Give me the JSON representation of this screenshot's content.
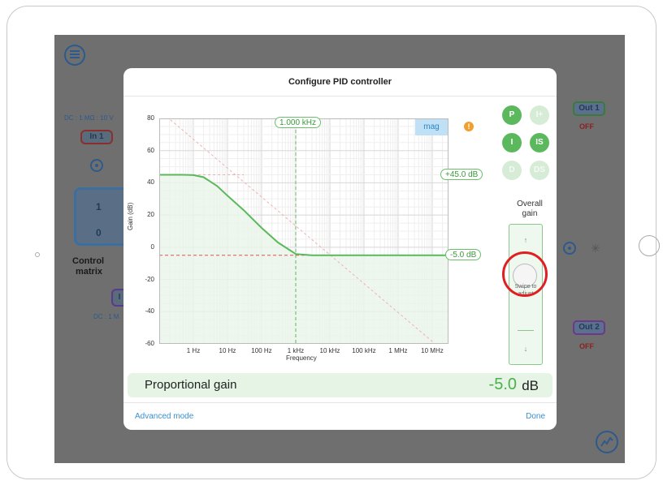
{
  "dialog": {
    "title": "Configure PID controller",
    "advanced_label": "Advanced mode",
    "done_label": "Done"
  },
  "chart": {
    "ylabel": "Gain (dB)",
    "xlabel": "Frequency",
    "y_ticks": [
      "80",
      "60",
      "40",
      "20",
      "0",
      "-20",
      "-40",
      "-60"
    ],
    "x_ticks": [
      "1 Hz",
      "10 Hz",
      "100 Hz",
      "1 kHz",
      "10 kHz",
      "100 kHz",
      "1 MHz",
      "10 MHz"
    ],
    "freq_marker": "1.000 kHz",
    "high_gain_marker": "+45.0 dB",
    "low_gain_marker": "-5.0 dB",
    "mode": "mag",
    "warning": "!"
  },
  "chart_data": {
    "type": "line",
    "x_scale": "log",
    "xlim_hz": [
      0.1,
      30000000
    ],
    "ylim": [
      -60,
      80
    ],
    "xlabel": "Frequency",
    "ylabel": "Gain (dB)",
    "series": [
      {
        "x_hz": [
          0.1,
          0.5,
          1,
          2,
          5,
          10,
          30,
          100,
          300,
          1000,
          3000,
          10000,
          100000,
          1000000,
          10000000,
          30000000
        ],
        "values": [
          45,
          45,
          44.8,
          43.5,
          38,
          32,
          23,
          12,
          3,
          -4.2,
          -5,
          -5,
          -5,
          -5,
          -5,
          -5
        ]
      }
    ],
    "reference_lines": {
      "vertical_hz": 1000,
      "horizontal_db": -5,
      "upper_plateau_db": 45
    },
    "colors": {
      "curve": "#5cb85c",
      "fill": "#e8f5e8",
      "red_dashed": "#e05050",
      "grid": "#e6e6e6"
    }
  },
  "terms": [
    {
      "label": "P",
      "active": true
    },
    {
      "label": "I+",
      "active": false
    },
    {
      "label": "I",
      "active": true
    },
    {
      "label": "IS",
      "active": true
    },
    {
      "label": "D",
      "active": false
    },
    {
      "label": "DS",
      "active": false
    }
  ],
  "overall_gain": {
    "title_line1": "Overall",
    "title_line2": "gain",
    "up": "↑",
    "down": "↓",
    "hint": "Swipe to adjust"
  },
  "proportional": {
    "label": "Proportional gain",
    "value": "-5.0",
    "unit": "dB"
  },
  "background": {
    "in1": "In 1",
    "in_info": "DC : 1 MΩ : 10 V",
    "in2_info": "DC : 1 M",
    "in2_label": "I",
    "out1": "Out 1",
    "out1_state": "OFF",
    "out2": "Out 2",
    "out2_state": "OFF",
    "matrix_label_1": "Control",
    "matrix_label_2": "matrix",
    "m11": "1",
    "m21": "0"
  }
}
